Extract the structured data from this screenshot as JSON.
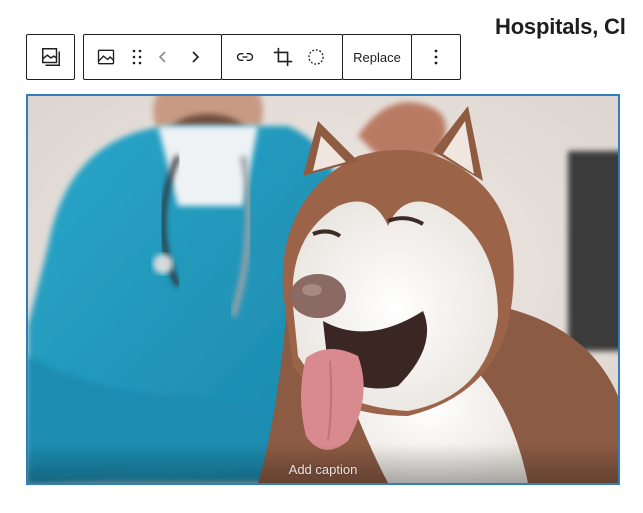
{
  "heading": "Hospitals, Cl",
  "toolbar": {
    "block_type_icon": "image-block-icon",
    "align_icon": "image-align-icon",
    "drag_icon": "drag-handle-icon",
    "move_left_icon": "chevron-left-icon",
    "move_right_icon": "chevron-right-icon",
    "link_icon": "link-icon",
    "crop_icon": "crop-icon",
    "select_icon": "dotted-circle-icon",
    "replace_label": "Replace",
    "more_icon": "more-vertical-icon"
  },
  "image": {
    "description_icon": "photo",
    "caption_placeholder": "Add caption"
  },
  "colors": {
    "toolbar_border": "#1e1e1e",
    "selection_border": "#2f7fbf",
    "heading_text": "#1e1e1e"
  }
}
